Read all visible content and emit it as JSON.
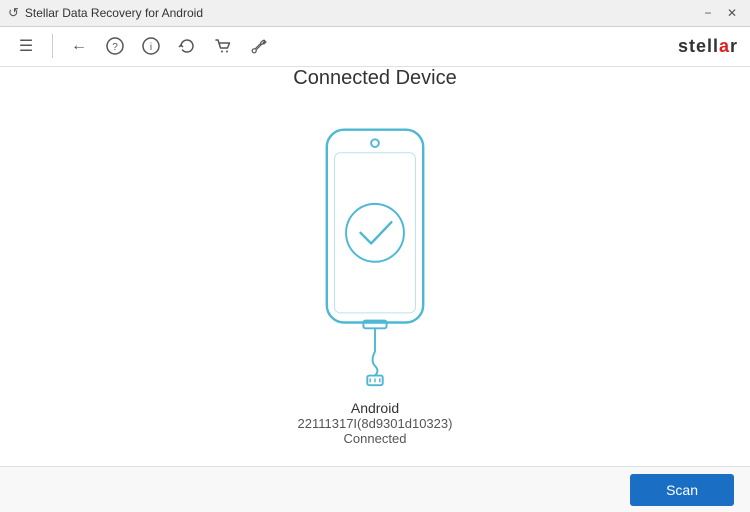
{
  "titlebar": {
    "icon": "↺",
    "title": "Stellar Data Recovery for Android",
    "minimize": "−",
    "close": "✕"
  },
  "toolbar": {
    "menu_icon": "☰",
    "back_icon": "←",
    "help_icon": "ⓘ",
    "info_icon": "①",
    "refresh_icon": "↻",
    "cart_icon": "⊡",
    "settings_icon": "🔧",
    "logo": "stellar"
  },
  "main": {
    "title": "Connected Device",
    "device_name": "Android",
    "device_id": "22111317I(8d9301d10323)",
    "device_status": "Connected"
  },
  "bottom": {
    "scan_label": "Scan"
  },
  "colors": {
    "phone_stroke": "#4db8d4",
    "check_circle": "#4db8d4",
    "scan_btn": "#1a6fc4"
  }
}
